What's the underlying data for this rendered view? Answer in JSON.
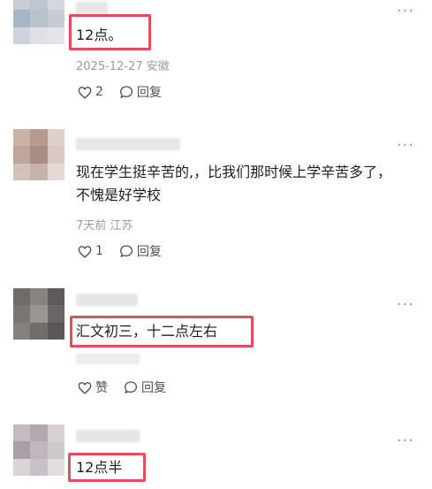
{
  "comments": [
    {
      "text": "12点。",
      "meta": "2025-12-27 安徽",
      "like_icon": "heart-outline-icon",
      "like_count": "2",
      "reply_icon": "speech-bubble-icon",
      "reply_label": "回复",
      "more_icon": "more-dots-icon",
      "more": "···",
      "highlighted": true
    },
    {
      "text": "现在学生挺辛苦的,，比我们那时候上学辛苦多了，不愧是好学校",
      "meta": "7天前 江苏",
      "like_icon": "heart-outline-icon",
      "like_count": "1",
      "reply_icon": "speech-bubble-icon",
      "reply_label": "回复",
      "more_icon": "more-dots-icon",
      "more": "···",
      "highlighted": false
    },
    {
      "text": "汇文初三，十二点左右",
      "meta": "",
      "like_icon": "heart-outline-icon",
      "like_count": "赞",
      "reply_icon": "speech-bubble-icon",
      "reply_label": "回复",
      "more_icon": "more-dots-icon",
      "more": "···",
      "highlighted": true
    },
    {
      "text": "12点半",
      "more_icon": "more-dots-icon",
      "more": "···",
      "highlighted": true
    }
  ],
  "colors": {
    "highlight_border": "#e0505a",
    "meta_text": "#9b9b9b",
    "action_text": "#505050"
  }
}
